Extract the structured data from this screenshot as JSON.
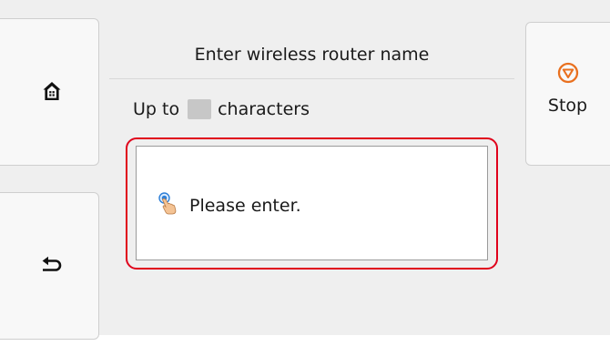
{
  "screen": {
    "title": "Enter wireless router name",
    "limit_prefix": "Up to",
    "limit_suffix": "characters",
    "prompt": "Please enter."
  },
  "controls": {
    "stop_label": "Stop"
  },
  "icons": {
    "home": "home-icon",
    "back": "back-arrow-icon",
    "stop": "stop-icon",
    "tap": "tap-finger-icon"
  },
  "colors": {
    "stop_accent": "#e9701f",
    "highlight": "#e0001b",
    "tap_blue": "#2f80d8"
  }
}
